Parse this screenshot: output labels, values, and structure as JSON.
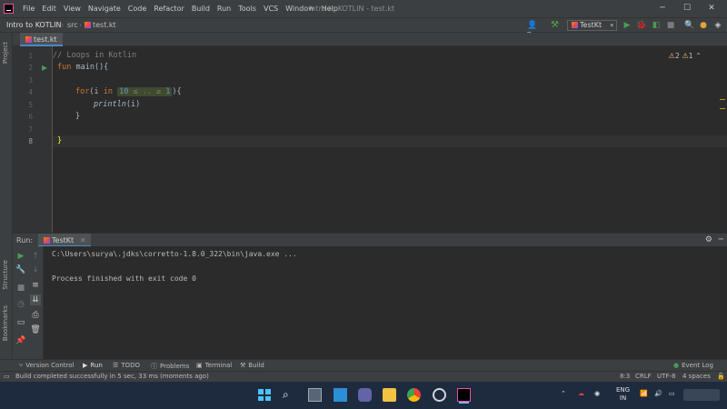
{
  "menubar": {
    "items": [
      "File",
      "Edit",
      "View",
      "Navigate",
      "Code",
      "Refactor",
      "Build",
      "Run",
      "Tools",
      "VCS",
      "Window",
      "Help"
    ],
    "window_title": "Intro to KOTLIN - test.kt"
  },
  "navbar": {
    "project": "Intro to KOTLIN",
    "folder": "src",
    "file": "test.kt",
    "run_config": "TestKt"
  },
  "left_strip": {
    "project_label": "Project",
    "structure_label": "Structure",
    "bookmarks_label": "Bookmarks"
  },
  "editor": {
    "tab_label": "test.kt",
    "line_numbers": [
      "1",
      "2",
      "3",
      "4",
      "5",
      "6",
      "7",
      "8"
    ],
    "code": {
      "l1_comment": "// Loops in Kotlin",
      "l2_kw": "fun",
      "l2_rest": " main(){",
      "l4_kw": "for",
      "l4_a": "(i ",
      "l4_in": "in",
      "l4_n1": "10",
      "l4_hint": " ≤ .. ≥ ",
      "l4_n2": "1",
      "l4_end": "){",
      "l5_fn": "println",
      "l5_args": "(i)",
      "l6_brace": "}",
      "l8_brace": "}"
    },
    "inspection": {
      "warnings": "2",
      "weak_warnings": "1"
    }
  },
  "run_panel": {
    "label": "Run:",
    "tab_label": "TestKt",
    "console_lines": [
      "C:\\Users\\surya\\.jdks\\corretto-1.8.0_322\\bin\\java.exe ...",
      "",
      "Process finished with exit code 0"
    ]
  },
  "tool_tabs": {
    "version_control": "Version Control",
    "run": "Run",
    "todo": "TODO",
    "problems": "Problems",
    "terminal": "Terminal",
    "build": "Build",
    "event_log": "Event Log"
  },
  "statusbar": {
    "message": "Build completed successfully in 5 sec, 33 ms (moments ago)",
    "position": "8:3",
    "line_sep": "CRLF",
    "encoding": "UTF-8",
    "indent": "4 spaces"
  },
  "taskbar": {
    "lang_line1": "ENG",
    "lang_line2": "IN"
  },
  "colors": {
    "accent_blue": "#4a88c7",
    "run_green": "#499c54",
    "kotlin_keyword": "#cc7832",
    "number": "#6897bb",
    "comment": "#808080"
  }
}
